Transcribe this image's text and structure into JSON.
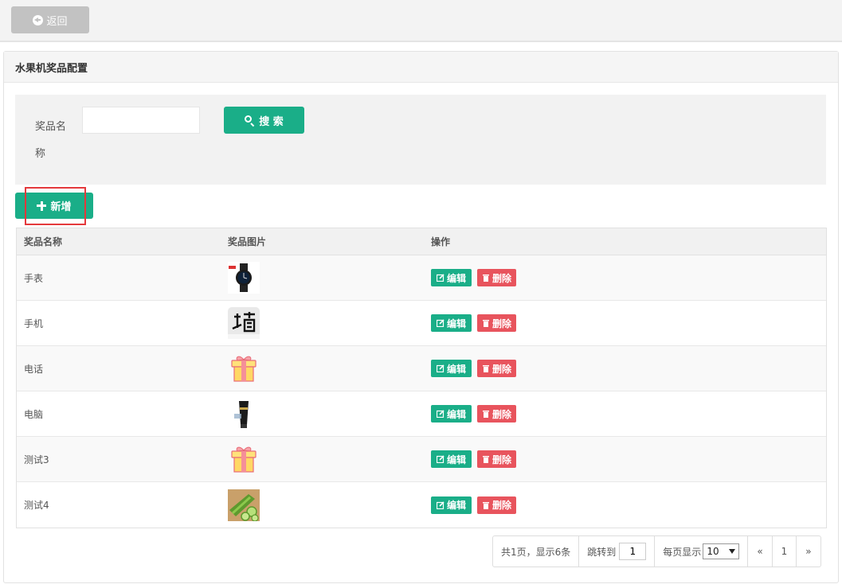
{
  "topbar": {
    "back_label": "返回"
  },
  "panel": {
    "title": "水果机奖品配置"
  },
  "search": {
    "label": "奖品名称",
    "input_value": "",
    "button_label": "搜 索"
  },
  "add_label": "新增",
  "table": {
    "columns": [
      "奖品名称",
      "奖品图片",
      "操作"
    ],
    "rows": [
      {
        "name": "手表",
        "image": "watch-image"
      },
      {
        "name": "手机",
        "image": "wall-char-image"
      },
      {
        "name": "电话",
        "image": "gift-box-image"
      },
      {
        "name": "电脑",
        "image": "product-tube-image"
      },
      {
        "name": "测试3",
        "image": "gift-box-image"
      },
      {
        "name": "测试4",
        "image": "cucumber-image"
      }
    ],
    "edit_label": "编辑",
    "delete_label": "删除"
  },
  "pager": {
    "summary": "共1页，显示6条",
    "jump_label": "跳转到",
    "jump_value": "1",
    "per_page_label": "每页显示",
    "per_page_value": "10",
    "prev": "«",
    "current": "1",
    "next": "»"
  },
  "colors": {
    "primary": "#1aae88",
    "danger": "#e8545d",
    "back": "#c2c2c2",
    "highlight": "#e4393c"
  }
}
